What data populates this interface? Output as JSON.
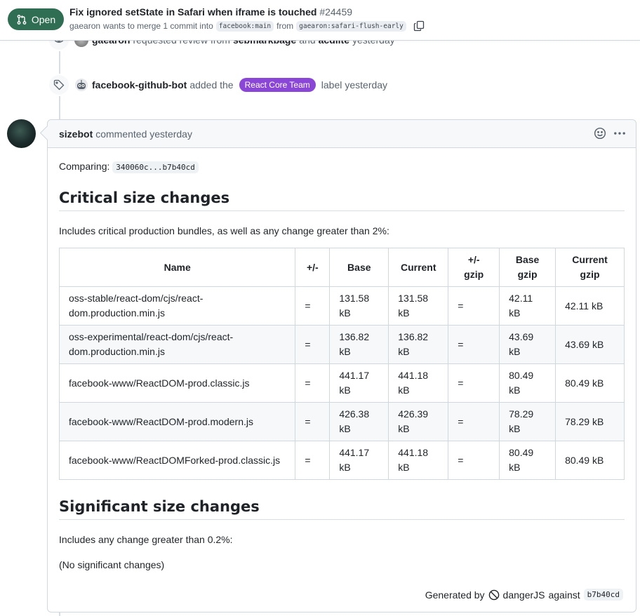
{
  "header": {
    "state": "Open",
    "title": "Fix ignored setState in Safari when iframe is touched",
    "number": "#24459",
    "author": "gaearon",
    "merge_text": "wants to merge 1 commit into",
    "base_branch": "facebook:main",
    "from_text": "from",
    "head_branch": "gaearon:safari-flush-early"
  },
  "timeline": [
    {
      "actor": "gaearon",
      "text": "requested review from",
      "reviewer1": "sebmarkbage",
      "and": "and",
      "reviewer2": "acdlite",
      "time": "yesterday",
      "icon": "eye-icon"
    },
    {
      "actor": "facebook-github-bot",
      "text": "added the",
      "label": "React Core Team",
      "label_color": "#8a46d6",
      "suffix": "label",
      "time": "yesterday",
      "icon": "tag-icon"
    }
  ],
  "comment": {
    "author": "sizebot",
    "action": "commented yesterday",
    "comparing_label": "Comparing:",
    "comparing_value": "340060c...b7b40cd",
    "critical_heading": "Critical size changes",
    "critical_desc": "Includes critical production bundles, as well as any change greater than 2%:",
    "table_headers": [
      "Name",
      "+/-",
      "Base",
      "Current",
      "+/- gzip",
      "Base gzip",
      "Current gzip"
    ],
    "rows": [
      [
        "oss-stable/react-dom/cjs/react-dom.production.min.js",
        "=",
        "131.58 kB",
        "131.58 kB",
        "=",
        "42.11 kB",
        "42.11 kB"
      ],
      [
        "oss-experimental/react-dom/cjs/react-dom.production.min.js",
        "=",
        "136.82 kB",
        "136.82 kB",
        "=",
        "43.69 kB",
        "43.69 kB"
      ],
      [
        "facebook-www/ReactDOM-prod.classic.js",
        "=",
        "441.17 kB",
        "441.18 kB",
        "=",
        "80.49 kB",
        "80.49 kB"
      ],
      [
        "facebook-www/ReactDOM-prod.modern.js",
        "=",
        "426.38 kB",
        "426.39 kB",
        "=",
        "78.29 kB",
        "78.29 kB"
      ],
      [
        "facebook-www/ReactDOMForked-prod.classic.js",
        "=",
        "441.17 kB",
        "441.18 kB",
        "=",
        "80.49 kB",
        "80.49 kB"
      ]
    ],
    "significant_heading": "Significant size changes",
    "significant_desc": "Includes any change greater than 0.2%:",
    "no_changes": "(No significant changes)",
    "footer_generated": "Generated by",
    "footer_tool": "dangerJS",
    "footer_against": "against",
    "footer_commit": "b7b40cd"
  },
  "colors": {
    "open_badge": "#2f6e52",
    "label": "#8a46d6"
  }
}
